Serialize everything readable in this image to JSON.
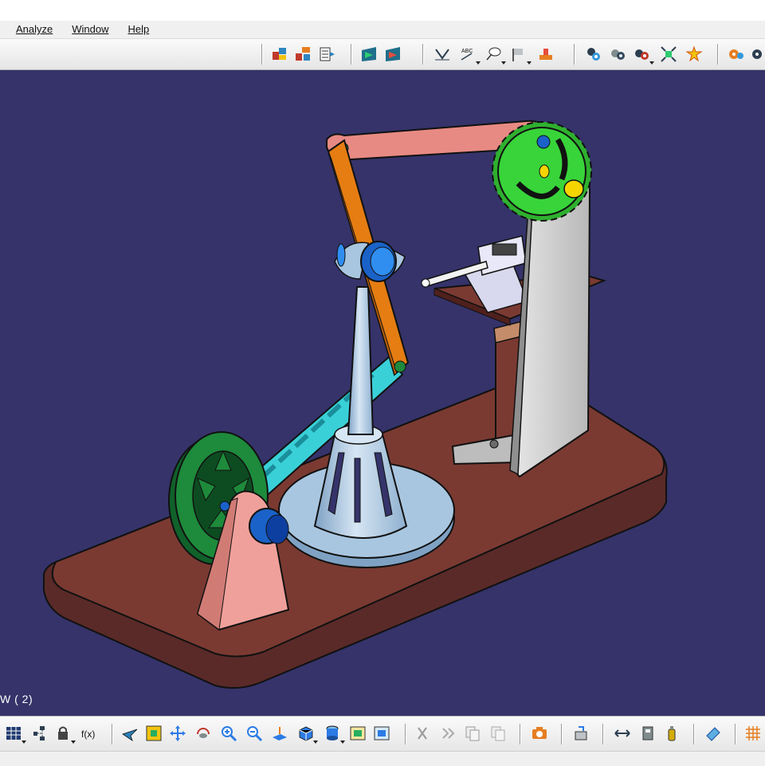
{
  "menu": [
    {
      "label": "Analyze"
    },
    {
      "label": "Window"
    },
    {
      "label": "Help"
    }
  ],
  "viewport": {
    "label": "W ( 2)",
    "background": "#35336a"
  },
  "colors": {
    "base": "#7a3a32",
    "flywheel": "#1e8a3b",
    "gear": "#38d43a",
    "pedestal": "#a9c6e0",
    "link_orange": "#e57d12",
    "link_salmon": "#e88a84",
    "link_cyan": "#3ad0d8",
    "bracket": "#c8c8c8"
  },
  "toolbar_top": {
    "icons": [
      "assembly-constraint-icon",
      "product-structure-icon",
      "bom-icon",
      "section-cut-icon",
      "clash-icon",
      "annotation-icon",
      "text-note-icon",
      "balloon-icon",
      "flag-icon",
      "weld-icon",
      "catalog-icon",
      "fastener-icon",
      "component-icon",
      "explode-icon",
      "tools-icon",
      "gear-settings-icon"
    ]
  },
  "toolbar_bottom": {
    "icons": [
      "grid-icon",
      "tree-icon",
      "lock-icon",
      "formula-icon",
      "fly-mode-icon",
      "fit-all-icon",
      "pan-icon",
      "rotate-icon",
      "zoom-in-icon",
      "zoom-out-icon",
      "normal-view-icon",
      "iso-view-icon",
      "shading-icon",
      "hide-show-icon",
      "swap-visible-icon",
      "cut-icon",
      "paste-icon",
      "copy-icon",
      "capture-icon",
      "update-icon",
      "measure-between-icon",
      "measure-item-icon",
      "inertia-icon",
      "sketch-icon",
      "grid-snap-icon"
    ]
  }
}
